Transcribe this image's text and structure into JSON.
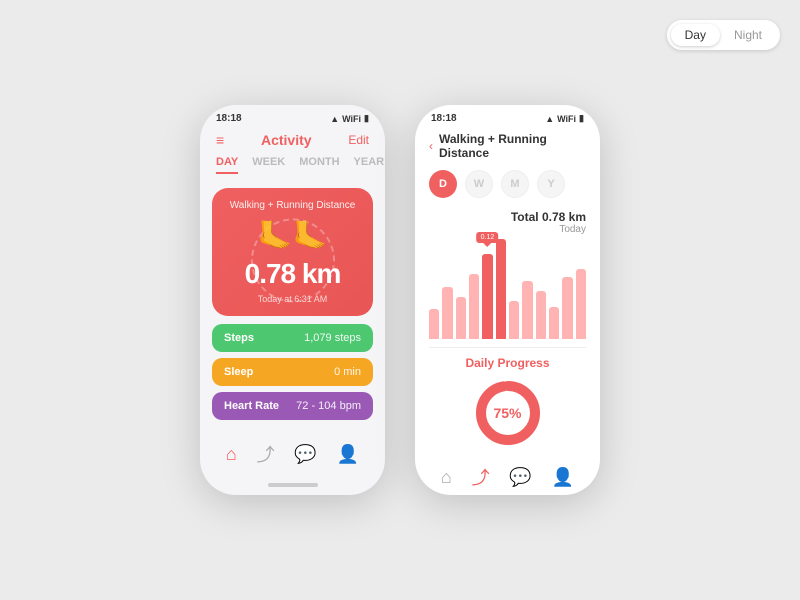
{
  "toggle": {
    "day_label": "Day",
    "night_label": "Night",
    "active": "day"
  },
  "phone1": {
    "status_bar": {
      "time": "18:18",
      "icons": "▲ WiFi 🔋"
    },
    "header": {
      "menu_icon": "≡",
      "title": "Activity",
      "edit": "Edit"
    },
    "tabs": [
      "DAY",
      "WEEK",
      "MONTH",
      "YEAR"
    ],
    "active_tab": "DAY",
    "activity_card": {
      "title": "Walking + Running Distance",
      "footsteps": "👣",
      "distance": "0.78",
      "unit": " km",
      "time_label": "Today at 6:31 AM"
    },
    "stats": [
      {
        "label": "Steps",
        "value": "1,079 steps",
        "type": "steps"
      },
      {
        "label": "Sleep",
        "value": "0 min",
        "type": "sleep"
      },
      {
        "label": "Heart Rate",
        "value": "72 - 104 bpm",
        "type": "heart"
      }
    ],
    "nav_icons": [
      "🏠",
      "📈",
      "💬",
      "👤"
    ]
  },
  "phone2": {
    "status_bar": {
      "time": "18:18",
      "icons": "▲ WiFi 🔋"
    },
    "header": {
      "back": "‹",
      "title": "Walking + Running Distance"
    },
    "period_tabs": [
      {
        "label": "D",
        "active": true
      },
      {
        "label": "W",
        "active": false
      },
      {
        "label": "M",
        "active": false
      },
      {
        "label": "Y",
        "active": false
      }
    ],
    "chart": {
      "total_label": "Total 0.78 km",
      "sub_label": "Today",
      "tooltip": "0.12",
      "bars": [
        30,
        55,
        45,
        70,
        85,
        95,
        40,
        60,
        50,
        35,
        65,
        75
      ]
    },
    "daily_progress": {
      "title": "Daily Progress",
      "percentage": "75%",
      "value": 75
    },
    "nav_icons": [
      "🏠",
      "📈",
      "💬",
      "👤"
    ],
    "active_nav": 1
  }
}
